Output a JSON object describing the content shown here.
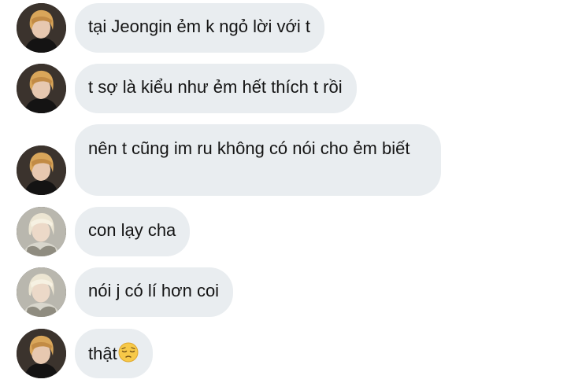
{
  "messages": [
    {
      "text": "tại Jeongin ẻm k ngỏ lời với t",
      "avatar": "blonde-avatar-icon"
    },
    {
      "text": "t sợ là kiểu như ẻm hết thích t rồi",
      "avatar": "blonde-avatar-icon"
    },
    {
      "text": "nên t cũng im ru không có nói cho ẻm biết",
      "avatar": "blonde-avatar-icon"
    },
    {
      "text": "con lạy cha",
      "avatar": "silver-hair-avatar-icon"
    },
    {
      "text": "nói j có lí hơn coi",
      "avatar": "silver-hair-avatar-icon"
    },
    {
      "text": "thật",
      "emoji": "pensive-face-emoji-icon",
      "avatar": "blonde-avatar-icon"
    }
  ],
  "colors": {
    "bubble": "#e9edf0",
    "text": "#141414",
    "background": "#ffffff"
  }
}
